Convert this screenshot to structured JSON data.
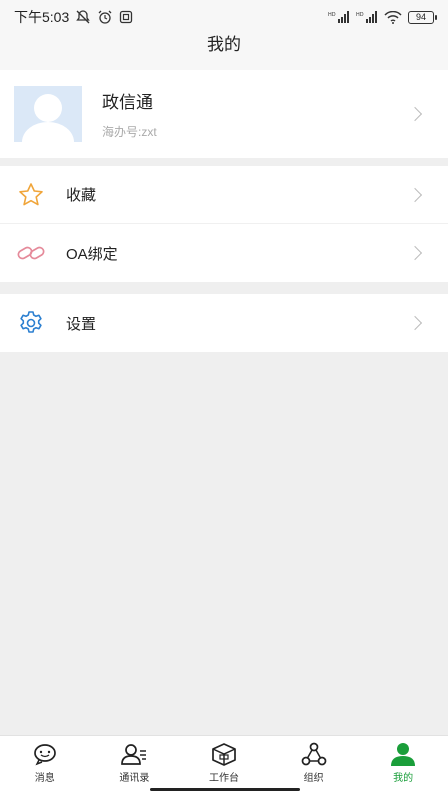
{
  "status_bar": {
    "time": "下午5:03",
    "battery": "94"
  },
  "header": {
    "title": "我的"
  },
  "profile": {
    "name": "政信通",
    "id_text": "海办号:zxt"
  },
  "menu": {
    "favorites_label": "收藏",
    "oa_bind_label": "OA绑定",
    "settings_label": "设置"
  },
  "bottom_nav": {
    "items": [
      {
        "label": "消息",
        "icon": "message-icon"
      },
      {
        "label": "通讯录",
        "icon": "contacts-icon"
      },
      {
        "label": "工作台",
        "icon": "workbench-icon"
      },
      {
        "label": "组织",
        "icon": "organization-icon"
      },
      {
        "label": "我的",
        "icon": "me-icon"
      }
    ],
    "active_index": 4
  },
  "colors": {
    "accent": "#1a9e3a",
    "star": "#f0a53a",
    "link": "#e58a9a",
    "gear": "#2b7fd0"
  }
}
